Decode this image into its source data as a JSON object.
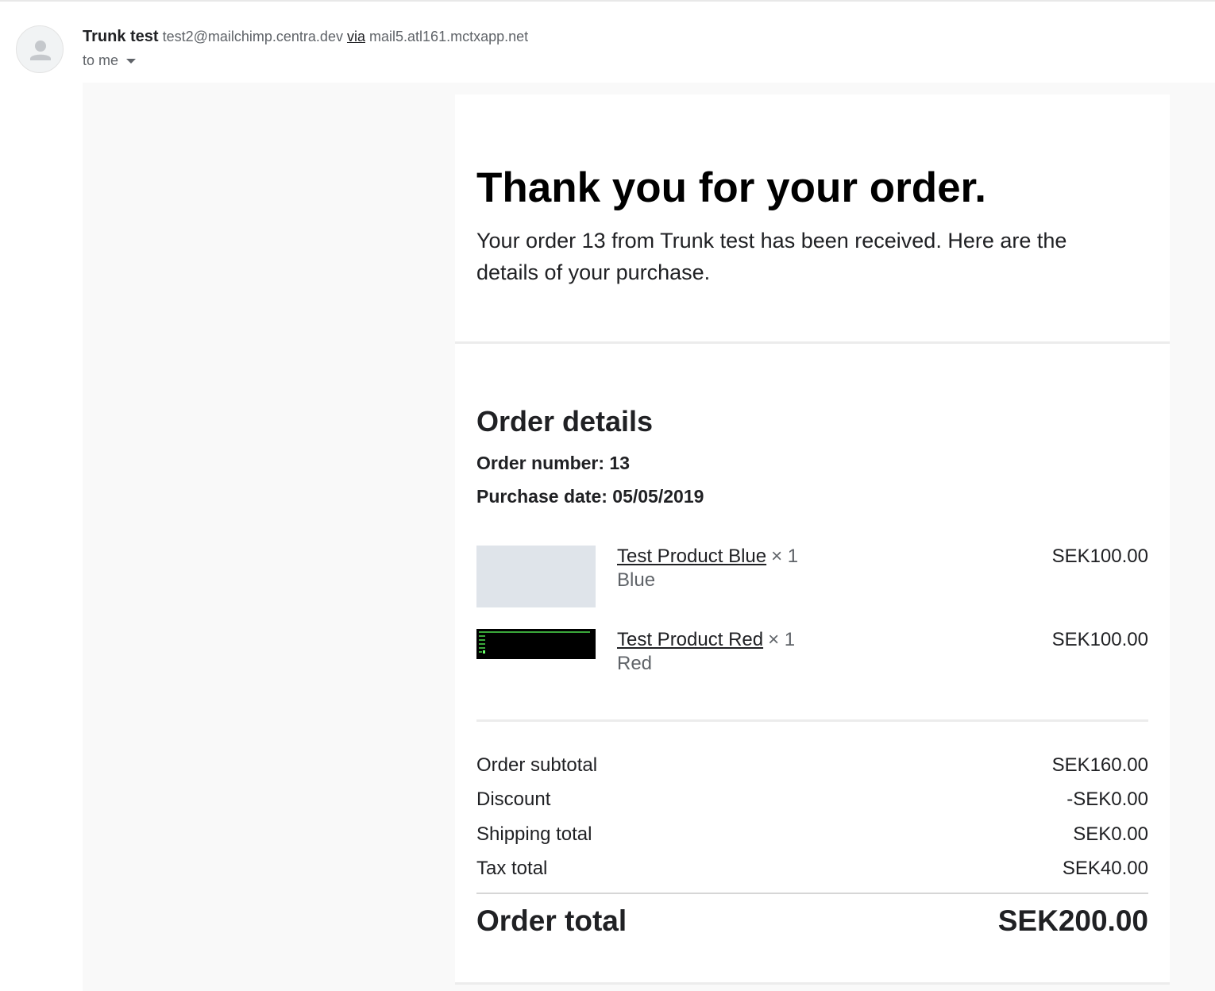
{
  "header": {
    "sender_name": "Trunk test",
    "sender_email": "test2@mailchimp.centra.dev",
    "via_label": "via",
    "via_host": "mail5.atl161.mctxapp.net",
    "to_label": "to me",
    "avatar_icon": "person-icon"
  },
  "email": {
    "headline": "Thank you for your order.",
    "intro": "Your order 13 from Trunk test has been received. Here are the details of your purchase.",
    "order_details_title": "Order details",
    "order_number_line": "Order number: 13",
    "purchase_date_line": "Purchase date: 05/05/2019",
    "items": [
      {
        "name": "Test Product Blue",
        "qty": "× 1",
        "variant": "Blue",
        "price": "SEK100.00",
        "thumb_color": "#dfe4ea"
      },
      {
        "name": "Test Product Red",
        "qty": "× 1",
        "variant": "Red",
        "price": "SEK100.00",
        "thumb_color": "#000000"
      }
    ],
    "summary": {
      "subtotal_label": "Order subtotal",
      "subtotal_value": "SEK160.00",
      "discount_label": "Discount",
      "discount_value": "-SEK0.00",
      "shipping_label": "Shipping total",
      "shipping_value": "SEK0.00",
      "tax_label": "Tax total",
      "tax_value": "SEK40.00",
      "total_label": "Order total",
      "total_value": "SEK200.00"
    }
  }
}
